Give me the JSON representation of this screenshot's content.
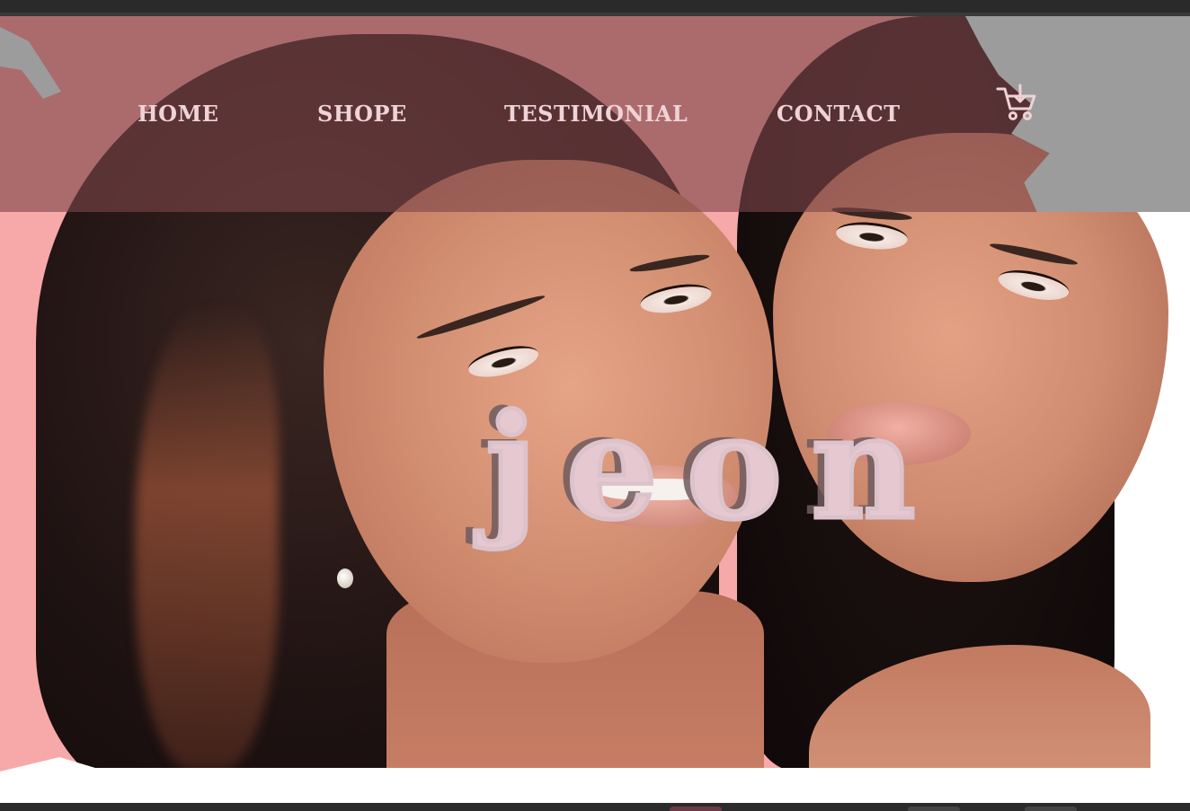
{
  "nav": {
    "items": [
      {
        "label": "HOME"
      },
      {
        "label": "SHOPE"
      },
      {
        "label": "TESTIMONIAL"
      },
      {
        "label": "CONTACT"
      }
    ],
    "cart_icon": "shopping-cart-icon"
  },
  "hero": {
    "brand": "jeon"
  },
  "colors": {
    "nav_overlay": "#7d4648",
    "nav_text": "#efd3d6",
    "hero_background": "#f7a9a9",
    "brand_text": "#e6c9d0"
  }
}
